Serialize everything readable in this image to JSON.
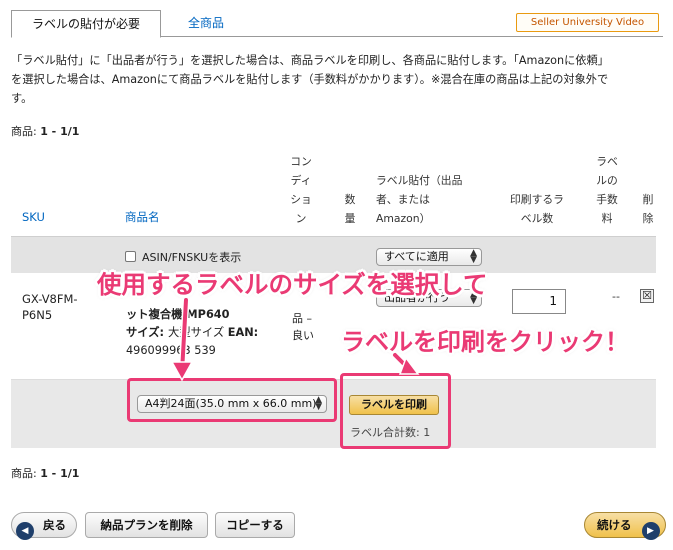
{
  "tabs": {
    "active": "ラベルの貼付が必要",
    "inactive": "全商品",
    "video_button": "Seller University Video"
  },
  "description": {
    "line1": "「ラベル貼付」に「出品者が行う」を選択した場合は、商品ラベルを印刷し、各商品に貼付します。「Amazonに依頼」",
    "line2": "を選択した場合は、Amazonにて商品ラベルを貼付します（手数料がかかります）。※混合在庫の商品は上記の対象外で",
    "line3": "す。"
  },
  "item_count": {
    "label": "商品: ",
    "value": "1 - 1/1"
  },
  "table": {
    "headers": {
      "sku": "SKU",
      "product_name": "商品名",
      "condition": [
        "コン",
        "ディ",
        "ショ",
        "ン"
      ],
      "quantity": [
        "数",
        "量"
      ],
      "label_affix": [
        "ラベル貼付（出品",
        "者、または",
        "Amazon）"
      ],
      "labels_to_print": [
        "印刷するラ",
        "ベル数"
      ],
      "label_fee": [
        "ラベ",
        "ルの",
        "手数",
        "料"
      ],
      "delete": [
        "削",
        "除"
      ]
    },
    "filter": {
      "show_asin_label": "ASIN/FNSKUを表示",
      "apply_all_value": "すべてに適用"
    },
    "row": {
      "sku": [
        "GX-V8FM-",
        "P6N5"
      ],
      "product_name_partial": "ット複合機 MP640",
      "size_label": "サイズ: ",
      "size_value": "大型サイズ ",
      "ean_label": "EAN: ",
      "ean_value": "496099963 539",
      "condition": [
        "品 –",
        "良い"
      ],
      "affix_select_value": "出品者が行う",
      "quantity_to_print": "1",
      "fee": "--",
      "delete_icon": "☒"
    },
    "footer": {
      "label_size_value": "A4判24面(35.0 mm x 66.0 mm)",
      "print_button": "ラベルを印刷",
      "total_labels_label": "ラベル合計数: ",
      "total_labels_value": "1"
    }
  },
  "buttons": {
    "back": "戻る",
    "delete_plan": "納品プランを削除",
    "copy": "コピーする",
    "continue": "続ける"
  },
  "annotations": {
    "select_size": "使用するラベルのサイズを選択して",
    "click_print": "ラベルを印刷をクリック！",
    "color": "#ea3a74"
  }
}
